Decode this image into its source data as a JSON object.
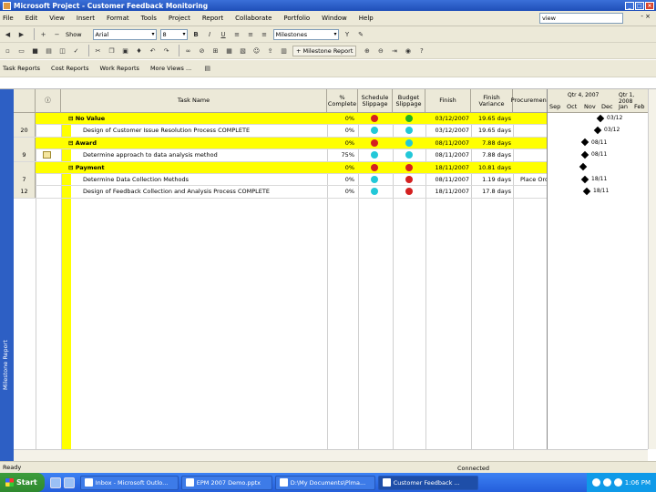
{
  "window": {
    "title": "Microsoft Project - Customer Feedback Monitoring",
    "controls": [
      "_",
      "□",
      "×"
    ]
  },
  "menu": {
    "items": [
      "File",
      "Edit",
      "View",
      "Insert",
      "Format",
      "Tools",
      "Project",
      "Report",
      "Collaborate",
      "Portfolio",
      "Window",
      "Help"
    ],
    "help_box": "view",
    "doc_close": "- ×"
  },
  "toolbar1": {
    "show_label": "Show",
    "font": "Arial",
    "size": "8",
    "filter": "Milestones"
  },
  "toolbar2": {
    "milestone_button": "+ Milestone Report"
  },
  "toolbar3": {
    "items": [
      "Task Reports",
      "Cost Reports",
      "Work Reports",
      "More Views ..."
    ]
  },
  "viewbar": {
    "label": "Milestone Report"
  },
  "table": {
    "headers": {
      "id": "",
      "indicators": "ⓘ",
      "task_name": "Task Name",
      "pct_complete": "% Complete",
      "schedule_slippage": "Schedule Slippage",
      "budget_slippage": "Budget Slippage",
      "finish": "Finish",
      "finish_variance": "Finish Variance",
      "procurement": "Procurement"
    },
    "rows": [
      {
        "id": "",
        "indicator": "",
        "summary": true,
        "task": "⊟ No Value",
        "pct": "0%",
        "sched": "red",
        "budget": "green",
        "finish": "03/12/2007",
        "variance": "19.65 days",
        "proc": ""
      },
      {
        "id": "20",
        "indicator": "",
        "summary": false,
        "task": "Design of Customer Issue Resolution Process COMPLETE",
        "pct": "0%",
        "sched": "cyan",
        "budget": "cyan",
        "finish": "03/12/2007",
        "variance": "19.65 days",
        "proc": ""
      },
      {
        "id": "",
        "indicator": "",
        "summary": true,
        "task": "⊟ Award",
        "pct": "0%",
        "sched": "red",
        "budget": "cyan",
        "finish": "08/11/2007",
        "variance": "7.88 days",
        "proc": ""
      },
      {
        "id": "9",
        "indicator": "note",
        "summary": false,
        "task": "Determine approach to data analysis method",
        "pct": "75%",
        "sched": "cyan",
        "budget": "cyan",
        "finish": "08/11/2007",
        "variance": "7.88 days",
        "proc": ""
      },
      {
        "id": "",
        "indicator": "",
        "summary": true,
        "task": "⊟ Payment",
        "pct": "0%",
        "sched": "red",
        "budget": "red",
        "finish": "18/11/2007",
        "variance": "10.81 days",
        "proc": ""
      },
      {
        "id": "7",
        "indicator": "",
        "summary": false,
        "task": "Determine Data Collection Methods",
        "pct": "0%",
        "sched": "cyan",
        "budget": "red",
        "finish": "08/11/2007",
        "variance": "1.19 days",
        "proc": "Place Order"
      },
      {
        "id": "12",
        "indicator": "",
        "summary": false,
        "task": "Design of Feedback Collection and Analysis Process COMPLETE",
        "pct": "0%",
        "sched": "cyan",
        "budget": "red",
        "finish": "18/11/2007",
        "variance": "17.8 days",
        "proc": ""
      }
    ]
  },
  "gantt": {
    "weeks": [
      "Qtr 4, 2007",
      "Qtr 1, 2008"
    ],
    "months": [
      "Sep",
      "Oct",
      "Nov",
      "Dec",
      "Jan",
      "Feb"
    ],
    "labels": [
      "03/12",
      "03/12",
      "08/11",
      "08/11",
      "",
      "18/11",
      "18/11"
    ]
  },
  "status": {
    "left": "Ready",
    "connection": "Connected"
  },
  "taskbar": {
    "start": "Start",
    "buttons": [
      "Inbox - Microsoft Outlo...",
      "EPM 2007 Demo.pptx",
      "D:\\My Documents\\Plma...",
      "Customer Feedback ..."
    ],
    "clock": "1:06 PM"
  },
  "colors": {
    "red": "#d42020",
    "green": "#22b022",
    "cyan": "#22c8d8",
    "summary_bg": "#ffff00",
    "title_blue": "#2a5cc6"
  }
}
